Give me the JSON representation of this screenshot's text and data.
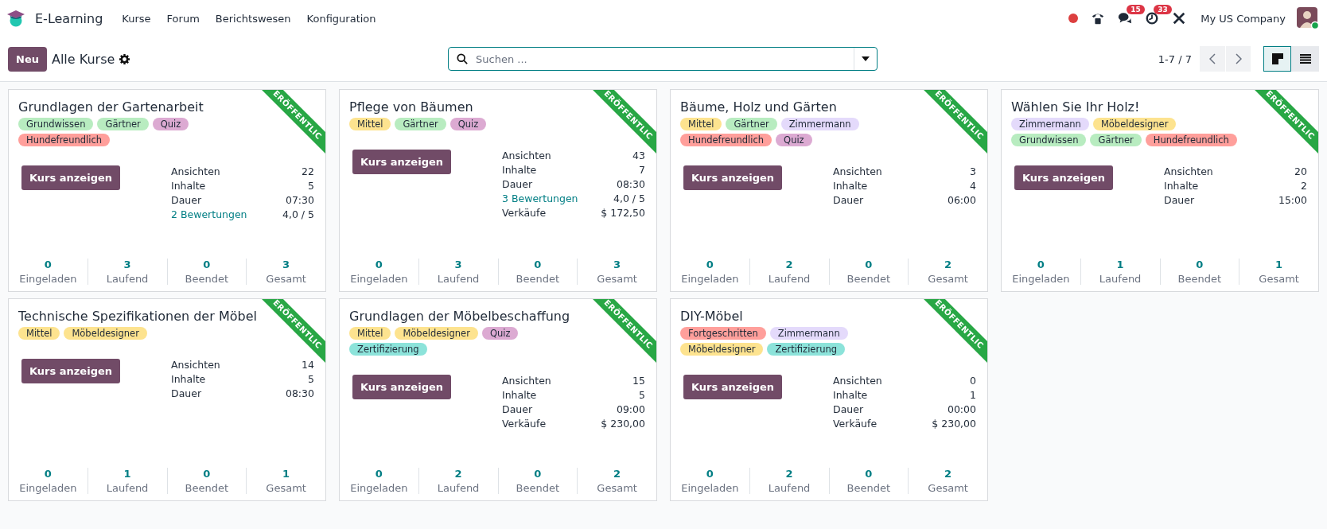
{
  "navbar": {
    "app_name": "E-Learning",
    "menu": [
      {
        "label": "Kurse"
      },
      {
        "label": "Forum"
      },
      {
        "label": "Berichtswesen"
      },
      {
        "label": "Konfiguration"
      }
    ],
    "messages_badge": "15",
    "activities_badge": "33",
    "company": "My US Company"
  },
  "control_panel": {
    "new_button": "Neu",
    "title": "Alle Kurse",
    "search": {
      "placeholder": "Suchen ..."
    },
    "pager": "1-7 / 7",
    "views": [
      {
        "kind": "kanban",
        "selected": true
      },
      {
        "kind": "list",
        "selected": false
      }
    ]
  },
  "courses": [
    {
      "title": "Grundlagen der Gartenarbeit",
      "ribbon": "ERÖFFENTLIC",
      "tags": [
        {
          "label": "Grundwissen",
          "color": "#b8ecc0"
        },
        {
          "label": "Gärtner",
          "color": "#b8ecc0"
        },
        {
          "label": "Quiz",
          "color": "#dcaad2"
        },
        {
          "label": "Hundefreundlich",
          "color": "#ff9f9b"
        }
      ],
      "button": "Kurs anzeigen",
      "stats": [
        {
          "kind": "text",
          "label": "Ansichten",
          "value": "22"
        },
        {
          "kind": "text",
          "label": "Inhalte",
          "value": "5"
        },
        {
          "kind": "text",
          "label": "Dauer",
          "value": "07:30"
        },
        {
          "kind": "link",
          "label": "2 Bewertungen",
          "value": "4,0 / 5"
        }
      ],
      "counters": [
        {
          "value": "0",
          "label": "Eingeladen"
        },
        {
          "value": "3",
          "label": "Laufend"
        },
        {
          "value": "0",
          "label": "Beendet"
        },
        {
          "value": "3",
          "label": "Gesamt"
        }
      ]
    },
    {
      "title": "Pflege von Bäumen",
      "ribbon": "ERÖFFENTLIC",
      "tags": [
        {
          "label": "Mittel",
          "color": "#fde38f"
        },
        {
          "label": "Gärtner",
          "color": "#b8ecc0"
        },
        {
          "label": "Quiz",
          "color": "#dcaad2"
        }
      ],
      "button": "Kurs anzeigen",
      "stats": [
        {
          "kind": "text",
          "label": "Ansichten",
          "value": "43"
        },
        {
          "kind": "text",
          "label": "Inhalte",
          "value": "7"
        },
        {
          "kind": "text",
          "label": "Dauer",
          "value": "08:30"
        },
        {
          "kind": "link",
          "label": "3 Bewertungen",
          "value": "4,0 / 5"
        },
        {
          "kind": "text",
          "label": "Verkäufe",
          "value": "$ 172,50"
        }
      ],
      "counters": [
        {
          "value": "0",
          "label": "Eingeladen"
        },
        {
          "value": "3",
          "label": "Laufend"
        },
        {
          "value": "0",
          "label": "Beendet"
        },
        {
          "value": "3",
          "label": "Gesamt"
        }
      ]
    },
    {
      "title": "Bäume, Holz und Gärten",
      "ribbon": "ERÖFFENTLIC",
      "tags": [
        {
          "label": "Mittel",
          "color": "#fde38f"
        },
        {
          "label": "Gärtner",
          "color": "#b8ecc0"
        },
        {
          "label": "Zimmermann",
          "color": "#e4dafb"
        },
        {
          "label": "Hundefreundlich",
          "color": "#ff9f9b"
        },
        {
          "label": "Quiz",
          "color": "#dcaad2"
        }
      ],
      "button": "Kurs anzeigen",
      "stats": [
        {
          "kind": "text",
          "label": "Ansichten",
          "value": "3"
        },
        {
          "kind": "text",
          "label": "Inhalte",
          "value": "4"
        },
        {
          "kind": "text",
          "label": "Dauer",
          "value": "06:00"
        }
      ],
      "counters": [
        {
          "value": "0",
          "label": "Eingeladen"
        },
        {
          "value": "2",
          "label": "Laufend"
        },
        {
          "value": "0",
          "label": "Beendet"
        },
        {
          "value": "2",
          "label": "Gesamt"
        }
      ]
    },
    {
      "title": "Wählen Sie Ihr Holz!",
      "ribbon": "ERÖFFENTLIC",
      "tags": [
        {
          "label": "Zimmermann",
          "color": "#e4dafb"
        },
        {
          "label": "Möbeldesigner",
          "color": "#fde38f"
        },
        {
          "label": "Grundwissen",
          "color": "#b8ecc0"
        },
        {
          "label": "Gärtner",
          "color": "#b8ecc0"
        },
        {
          "label": "Hundefreundlich",
          "color": "#ff9f9b"
        }
      ],
      "button": "Kurs anzeigen",
      "stats": [
        {
          "kind": "text",
          "label": "Ansichten",
          "value": "20"
        },
        {
          "kind": "text",
          "label": "Inhalte",
          "value": "2"
        },
        {
          "kind": "text",
          "label": "Dauer",
          "value": "15:00"
        }
      ],
      "counters": [
        {
          "value": "0",
          "label": "Eingeladen"
        },
        {
          "value": "1",
          "label": "Laufend"
        },
        {
          "value": "0",
          "label": "Beendet"
        },
        {
          "value": "1",
          "label": "Gesamt"
        }
      ]
    },
    {
      "title": "Technische Spezifikationen der Möbel",
      "ribbon": "ERÖFFENTLIC",
      "tags": [
        {
          "label": "Mittel",
          "color": "#fde38f"
        },
        {
          "label": "Möbeldesigner",
          "color": "#fde38f"
        }
      ],
      "button": "Kurs anzeigen",
      "stats": [
        {
          "kind": "text",
          "label": "Ansichten",
          "value": "14"
        },
        {
          "kind": "text",
          "label": "Inhalte",
          "value": "5"
        },
        {
          "kind": "text",
          "label": "Dauer",
          "value": "08:30"
        }
      ],
      "counters": [
        {
          "value": "0",
          "label": "Eingeladen"
        },
        {
          "value": "1",
          "label": "Laufend"
        },
        {
          "value": "0",
          "label": "Beendet"
        },
        {
          "value": "1",
          "label": "Gesamt"
        }
      ]
    },
    {
      "title": "Grundlagen der Möbelbeschaffung",
      "ribbon": "ERÖFFENTLIC",
      "tags": [
        {
          "label": "Mittel",
          "color": "#fde38f"
        },
        {
          "label": "Möbeldesigner",
          "color": "#fde38f"
        },
        {
          "label": "Quiz",
          "color": "#dcaad2"
        },
        {
          "label": "Zertifizierung",
          "color": "#8ce3da"
        }
      ],
      "button": "Kurs anzeigen",
      "stats": [
        {
          "kind": "text",
          "label": "Ansichten",
          "value": "15"
        },
        {
          "kind": "text",
          "label": "Inhalte",
          "value": "5"
        },
        {
          "kind": "text",
          "label": "Dauer",
          "value": "09:00"
        },
        {
          "kind": "text",
          "label": "Verkäufe",
          "value": "$ 230,00"
        }
      ],
      "counters": [
        {
          "value": "0",
          "label": "Eingeladen"
        },
        {
          "value": "2",
          "label": "Laufend"
        },
        {
          "value": "0",
          "label": "Beendet"
        },
        {
          "value": "2",
          "label": "Gesamt"
        }
      ]
    },
    {
      "title": "DIY-Möbel",
      "ribbon": "ERÖFFENTLIC",
      "tags": [
        {
          "label": "Fortgeschritten",
          "color": "#ff9f9b"
        },
        {
          "label": "Zimmermann",
          "color": "#e4dafb"
        },
        {
          "label": "Möbeldesigner",
          "color": "#fde38f"
        },
        {
          "label": "Zertifizierung",
          "color": "#8ce3da"
        }
      ],
      "button": "Kurs anzeigen",
      "stats": [
        {
          "kind": "text",
          "label": "Ansichten",
          "value": "0"
        },
        {
          "kind": "text",
          "label": "Inhalte",
          "value": "1"
        },
        {
          "kind": "text",
          "label": "Dauer",
          "value": "00:00"
        },
        {
          "kind": "text",
          "label": "Verkäufe",
          "value": "$ 230,00"
        }
      ],
      "counters": [
        {
          "value": "0",
          "label": "Eingeladen"
        },
        {
          "value": "2",
          "label": "Laufend"
        },
        {
          "value": "0",
          "label": "Beendet"
        },
        {
          "value": "2",
          "label": "Gesamt"
        }
      ]
    }
  ]
}
